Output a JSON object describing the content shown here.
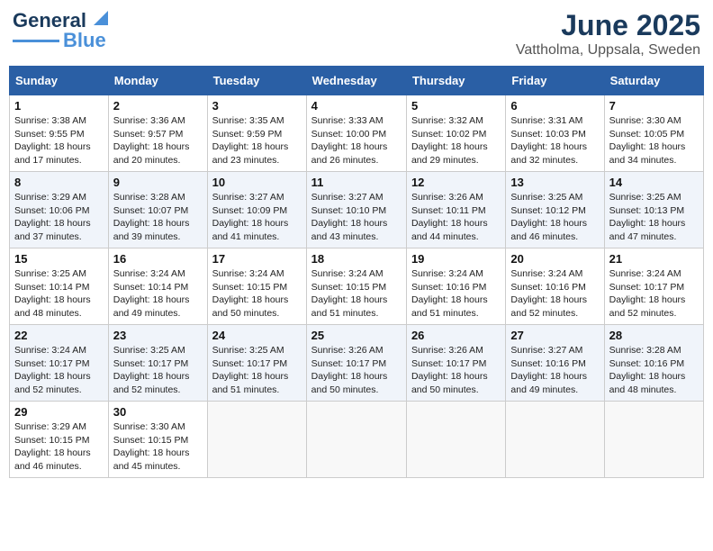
{
  "header": {
    "logo_line1": "General",
    "logo_line2": "Blue",
    "title": "June 2025",
    "subtitle": "Vattholma, Uppsala, Sweden"
  },
  "days_of_week": [
    "Sunday",
    "Monday",
    "Tuesday",
    "Wednesday",
    "Thursday",
    "Friday",
    "Saturday"
  ],
  "weeks": [
    [
      {
        "day": "1",
        "info": "Sunrise: 3:38 AM\nSunset: 9:55 PM\nDaylight: 18 hours\nand 17 minutes."
      },
      {
        "day": "2",
        "info": "Sunrise: 3:36 AM\nSunset: 9:57 PM\nDaylight: 18 hours\nand 20 minutes."
      },
      {
        "day": "3",
        "info": "Sunrise: 3:35 AM\nSunset: 9:59 PM\nDaylight: 18 hours\nand 23 minutes."
      },
      {
        "day": "4",
        "info": "Sunrise: 3:33 AM\nSunset: 10:00 PM\nDaylight: 18 hours\nand 26 minutes."
      },
      {
        "day": "5",
        "info": "Sunrise: 3:32 AM\nSunset: 10:02 PM\nDaylight: 18 hours\nand 29 minutes."
      },
      {
        "day": "6",
        "info": "Sunrise: 3:31 AM\nSunset: 10:03 PM\nDaylight: 18 hours\nand 32 minutes."
      },
      {
        "day": "7",
        "info": "Sunrise: 3:30 AM\nSunset: 10:05 PM\nDaylight: 18 hours\nand 34 minutes."
      }
    ],
    [
      {
        "day": "8",
        "info": "Sunrise: 3:29 AM\nSunset: 10:06 PM\nDaylight: 18 hours\nand 37 minutes."
      },
      {
        "day": "9",
        "info": "Sunrise: 3:28 AM\nSunset: 10:07 PM\nDaylight: 18 hours\nand 39 minutes."
      },
      {
        "day": "10",
        "info": "Sunrise: 3:27 AM\nSunset: 10:09 PM\nDaylight: 18 hours\nand 41 minutes."
      },
      {
        "day": "11",
        "info": "Sunrise: 3:27 AM\nSunset: 10:10 PM\nDaylight: 18 hours\nand 43 minutes."
      },
      {
        "day": "12",
        "info": "Sunrise: 3:26 AM\nSunset: 10:11 PM\nDaylight: 18 hours\nand 44 minutes."
      },
      {
        "day": "13",
        "info": "Sunrise: 3:25 AM\nSunset: 10:12 PM\nDaylight: 18 hours\nand 46 minutes."
      },
      {
        "day": "14",
        "info": "Sunrise: 3:25 AM\nSunset: 10:13 PM\nDaylight: 18 hours\nand 47 minutes."
      }
    ],
    [
      {
        "day": "15",
        "info": "Sunrise: 3:25 AM\nSunset: 10:14 PM\nDaylight: 18 hours\nand 48 minutes."
      },
      {
        "day": "16",
        "info": "Sunrise: 3:24 AM\nSunset: 10:14 PM\nDaylight: 18 hours\nand 49 minutes."
      },
      {
        "day": "17",
        "info": "Sunrise: 3:24 AM\nSunset: 10:15 PM\nDaylight: 18 hours\nand 50 minutes."
      },
      {
        "day": "18",
        "info": "Sunrise: 3:24 AM\nSunset: 10:15 PM\nDaylight: 18 hours\nand 51 minutes."
      },
      {
        "day": "19",
        "info": "Sunrise: 3:24 AM\nSunset: 10:16 PM\nDaylight: 18 hours\nand 51 minutes."
      },
      {
        "day": "20",
        "info": "Sunrise: 3:24 AM\nSunset: 10:16 PM\nDaylight: 18 hours\nand 52 minutes."
      },
      {
        "day": "21",
        "info": "Sunrise: 3:24 AM\nSunset: 10:17 PM\nDaylight: 18 hours\nand 52 minutes."
      }
    ],
    [
      {
        "day": "22",
        "info": "Sunrise: 3:24 AM\nSunset: 10:17 PM\nDaylight: 18 hours\nand 52 minutes."
      },
      {
        "day": "23",
        "info": "Sunrise: 3:25 AM\nSunset: 10:17 PM\nDaylight: 18 hours\nand 52 minutes."
      },
      {
        "day": "24",
        "info": "Sunrise: 3:25 AM\nSunset: 10:17 PM\nDaylight: 18 hours\nand 51 minutes."
      },
      {
        "day": "25",
        "info": "Sunrise: 3:26 AM\nSunset: 10:17 PM\nDaylight: 18 hours\nand 50 minutes."
      },
      {
        "day": "26",
        "info": "Sunrise: 3:26 AM\nSunset: 10:17 PM\nDaylight: 18 hours\nand 50 minutes."
      },
      {
        "day": "27",
        "info": "Sunrise: 3:27 AM\nSunset: 10:16 PM\nDaylight: 18 hours\nand 49 minutes."
      },
      {
        "day": "28",
        "info": "Sunrise: 3:28 AM\nSunset: 10:16 PM\nDaylight: 18 hours\nand 48 minutes."
      }
    ],
    [
      {
        "day": "29",
        "info": "Sunrise: 3:29 AM\nSunset: 10:15 PM\nDaylight: 18 hours\nand 46 minutes."
      },
      {
        "day": "30",
        "info": "Sunrise: 3:30 AM\nSunset: 10:15 PM\nDaylight: 18 hours\nand 45 minutes."
      },
      {
        "day": "",
        "info": ""
      },
      {
        "day": "",
        "info": ""
      },
      {
        "day": "",
        "info": ""
      },
      {
        "day": "",
        "info": ""
      },
      {
        "day": "",
        "info": ""
      }
    ]
  ]
}
